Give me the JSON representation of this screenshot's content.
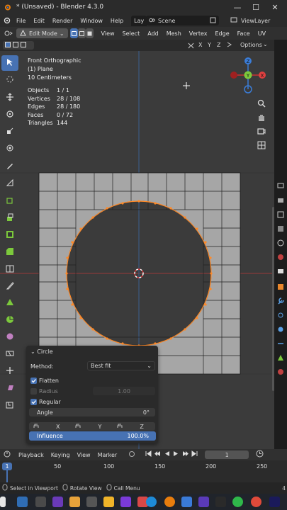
{
  "window": {
    "title": "* (Unsaved) - Blender 4.3.0"
  },
  "menubar": {
    "items": [
      "File",
      "Edit",
      "Render",
      "Window",
      "Help"
    ],
    "workspace_tab": "Lay",
    "scene": "Scene",
    "view_layer": "ViewLayer"
  },
  "header": {
    "mode": "Edit Mode",
    "menus": [
      "View",
      "Select",
      "Add",
      "Mesh",
      "Vertex",
      "Edge",
      "Face",
      "UV"
    ]
  },
  "toolheader": {
    "axes": [
      "X",
      "Y",
      "Z"
    ],
    "options": "Options"
  },
  "viewport": {
    "view_name": "Front Orthographic",
    "object_name": "(1) Plane",
    "scale": "10 Centimeters",
    "stats": [
      {
        "label": "Objects",
        "value": "1 / 1"
      },
      {
        "label": "Vertices",
        "value": "28 / 108"
      },
      {
        "label": "Edges",
        "value": "28 / 180"
      },
      {
        "label": "Faces",
        "value": "0 / 72"
      },
      {
        "label": "Triangles",
        "value": "144"
      }
    ],
    "gizmo": {
      "x": "X",
      "y": "Y",
      "z": "Z"
    }
  },
  "operator_panel": {
    "title": "Circle",
    "method_label": "Method:",
    "method_value": "Best fit",
    "flatten_label": "Flatten",
    "flatten": true,
    "radius_label": "Radius",
    "radius_value": "1.00",
    "regular_label": "Regular",
    "regular": true,
    "angle_label": "Angle",
    "angle_value": "0°",
    "lock_axes": [
      "X",
      "Y",
      "Z"
    ],
    "influence_label": "Influence",
    "influence_value": "100.0%"
  },
  "timeline": {
    "menus": [
      "Playback",
      "Keying",
      "View",
      "Marker"
    ],
    "current_frame": "1",
    "frame_labels": [
      "1",
      "50",
      "100",
      "150",
      "200",
      "250"
    ]
  },
  "statusbar": {
    "items": [
      "Select in Viewport",
      "Rotate View",
      "Call Menu"
    ],
    "right": "4"
  },
  "colors": {
    "accent": "#4772b3",
    "selection": "#ff8a28",
    "viewport_bg": "#3b3b3b",
    "mesh_face": "#a6a6a6"
  }
}
